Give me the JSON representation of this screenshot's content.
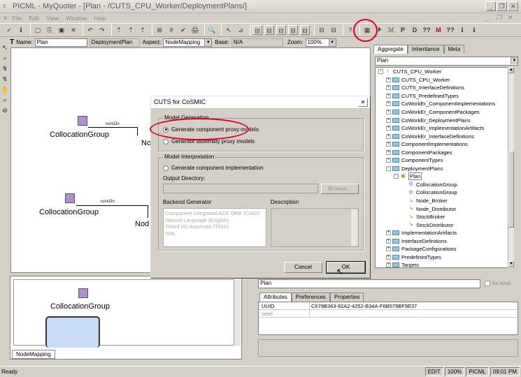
{
  "window": {
    "title": "PICML - MyQuoter - [Plan - /CUTS_CPU_Worker/DeploymentPlans/]",
    "controls": [
      "_",
      "❐",
      "✕"
    ],
    "inner_controls": [
      "_",
      "❐",
      "✕"
    ]
  },
  "menu": [
    "File",
    "Edit",
    "View",
    "Window",
    "Help"
  ],
  "toolbar": {
    "left_icons": [
      "✓",
      "ℹ",
      "▢",
      "⎘",
      "▣",
      "✕",
      "↶",
      "↷",
      "⇡",
      "⇡",
      "⇡",
      "⊞",
      "#",
      "✔",
      "🖨",
      "🔍",
      "↖",
      "⊿"
    ],
    "mid_icons": [
      "⊟",
      "⊟",
      "⊟",
      "⊟",
      "⊟",
      "⊟",
      "⊟",
      "⊟",
      "?"
    ],
    "right_icons": [
      "▦",
      "✈",
      "ℳ",
      "P",
      "D",
      "??",
      "M",
      "??",
      "ℹ",
      "ℹ"
    ]
  },
  "propbar": {
    "name_label": "Name:",
    "name_value": "Plan",
    "kind_value": "DeploymentPlan",
    "aspect_label": "Aspect:",
    "aspect_value": "NodeMapping",
    "base_label": "Base:",
    "base_value": "N/A",
    "zoom_label": "Zoom:",
    "zoom_value": "100%"
  },
  "canvas": {
    "nodes": [
      {
        "label": "CollocationGroup",
        "conn": "runsOn",
        "node": "Nod"
      },
      {
        "label": "CollocationGroup",
        "conn": "runsOn",
        "node": "Nod"
      }
    ]
  },
  "browser": {
    "tabs": [
      "Aggregate",
      "Inheritance",
      "Meta"
    ],
    "filter_value": "Plan",
    "tree": [
      {
        "label": "CUTS_CPU_Worker",
        "level": 0,
        "exp": "-",
        "icon": "root"
      },
      {
        "label": "CUTS_CPU_Worker",
        "level": 1,
        "exp": "+",
        "icon": "folder"
      },
      {
        "label": "CUTS_InterfaceDefinitions",
        "level": 1,
        "exp": "+",
        "icon": "folder"
      },
      {
        "label": "CUTS_PredefinedTypes",
        "level": 1,
        "exp": "+",
        "icon": "folder"
      },
      {
        "label": "CoWorkEr_ComponentImplementations",
        "level": 1,
        "exp": "+",
        "icon": "folder"
      },
      {
        "label": "CoWorkEr_ComponentPackages",
        "level": 1,
        "exp": "+",
        "icon": "folder"
      },
      {
        "label": "CoWorkEr_DeploymentPlans",
        "level": 1,
        "exp": "+",
        "icon": "folder"
      },
      {
        "label": "CoWorkEr_ImplementationArtifacts",
        "level": 1,
        "exp": "+",
        "icon": "folder"
      },
      {
        "label": "CoWorkEr_InterfaceDefinitions",
        "level": 1,
        "exp": "+",
        "icon": "folder"
      },
      {
        "label": "ComponentImplementations",
        "level": 1,
        "exp": "+",
        "icon": "folder"
      },
      {
        "label": "ComponentPackages",
        "level": 1,
        "exp": "+",
        "icon": "folder"
      },
      {
        "label": "ComponentTypes",
        "level": 1,
        "exp": "+",
        "icon": "folder"
      },
      {
        "label": "DeploymentPlans",
        "level": 1,
        "exp": "-",
        "icon": "folder"
      },
      {
        "label": "Plan",
        "level": 2,
        "exp": "-",
        "icon": "plan",
        "selected": true
      },
      {
        "label": "CollocationGroup",
        "level": 3,
        "exp": "",
        "icon": "cg"
      },
      {
        "label": "CollocationGroup",
        "level": 3,
        "exp": "",
        "icon": "cg"
      },
      {
        "label": "Node_Broker",
        "level": 3,
        "exp": "",
        "icon": "node"
      },
      {
        "label": "Node_Distributor",
        "level": 3,
        "exp": "",
        "icon": "node"
      },
      {
        "label": "StockBroker",
        "level": 3,
        "exp": "",
        "icon": "node"
      },
      {
        "label": "StockDistributor",
        "level": 3,
        "exp": "",
        "icon": "node"
      },
      {
        "label": "ImplementationArtifacts",
        "level": 1,
        "exp": "+",
        "icon": "folder"
      },
      {
        "label": "InterfaceDefinitions",
        "level": 1,
        "exp": "+",
        "icon": "folder"
      },
      {
        "label": "PackageConfigurations",
        "level": 1,
        "exp": "+",
        "icon": "folder"
      },
      {
        "label": "PredefinedTypes",
        "level": 1,
        "exp": "+",
        "icon": "folder"
      },
      {
        "label": "Targets",
        "level": 1,
        "exp": "+",
        "icon": "folder"
      }
    ]
  },
  "bottom_left": {
    "node_label": "CollocationGroup",
    "tab_label": "NodeMapping"
  },
  "attributes": {
    "name_value": "Plan",
    "for_kind_label": "for Kind",
    "tabs": [
      "Attributes",
      "Preferences",
      "Properties"
    ],
    "rows": [
      {
        "key": "UUID",
        "value": "C679B363-82A2-4252-B34A-F6B579BF9E37"
      },
      {
        "key": "label",
        "value": ""
      }
    ]
  },
  "dialog": {
    "title": "CUTS for CoSMIC",
    "close": "✕",
    "model_generation_label": "Model Generation",
    "gen_proxy_label": "Generate component proxy models",
    "gen_assembly_label": "Generate assembly proxy models",
    "model_interpretation_label": "Model Interpretation",
    "gen_impl_label": "Generate component implementation",
    "output_dir_label": "Output Directory:",
    "output_dir_value": "",
    "browse_label": "Browse...",
    "backend_label": "Backend Generator",
    "backends": [
      "Component Integrated ACE ORB (CIAO)",
      "Natural Language (English)",
      "Timed I/O Automata (TIOA)",
      "XML"
    ],
    "description_label": "Description",
    "cancel_label": "Cancel",
    "ok_label": "OK"
  },
  "status": {
    "left": "Ready",
    "cells": [
      "EDIT",
      "100%",
      "PICML",
      "09:01 PM"
    ]
  },
  "colors": {
    "annotation": "#e0001a",
    "selection": "#0a246a",
    "folder": "#8fc8e0"
  }
}
